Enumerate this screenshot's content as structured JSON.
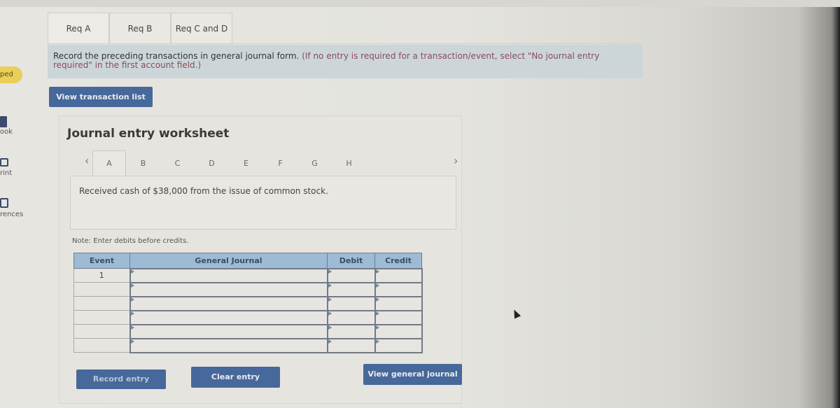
{
  "sidebar": {
    "badge": "ped",
    "items": [
      {
        "label": "ook",
        "icon": "book-icon"
      },
      {
        "label": "rint",
        "icon": "print-icon"
      },
      {
        "label": "rences",
        "icon": "references-icon"
      }
    ]
  },
  "req_tabs": [
    {
      "label": "Req A",
      "active": true
    },
    {
      "label": "Req B",
      "active": false
    },
    {
      "label": "Req C and D",
      "active": false
    }
  ],
  "instructions": {
    "main": "Record the preceding transactions in general journal form.",
    "note": "(If no entry is required for a transaction/event, select \"No journal entry required\" in the first account field.)"
  },
  "buttons": {
    "view_transaction_list": "View transaction list",
    "record_entry": "Record entry",
    "clear_entry": "Clear entry",
    "view_general_journal": "View general journal"
  },
  "worksheet": {
    "title": "Journal entry worksheet",
    "prev_icon": "‹",
    "next_icon": "›",
    "letter_tabs": [
      "A",
      "B",
      "C",
      "D",
      "E",
      "F",
      "G",
      "H"
    ],
    "active_tab": "A",
    "description": "Received cash of $38,000 from the issue of common stock.",
    "note": "Note: Enter debits before credits."
  },
  "journal_table": {
    "headers": {
      "event": "Event",
      "general_journal": "General Journal",
      "debit": "Debit",
      "credit": "Credit"
    },
    "rows": [
      {
        "event": "1",
        "account": "",
        "debit": "",
        "credit": ""
      },
      {
        "event": "",
        "account": "",
        "debit": "",
        "credit": ""
      },
      {
        "event": "",
        "account": "",
        "debit": "",
        "credit": ""
      },
      {
        "event": "",
        "account": "",
        "debit": "",
        "credit": ""
      },
      {
        "event": "",
        "account": "",
        "debit": "",
        "credit": ""
      },
      {
        "event": "",
        "account": "",
        "debit": "",
        "credit": ""
      }
    ]
  }
}
